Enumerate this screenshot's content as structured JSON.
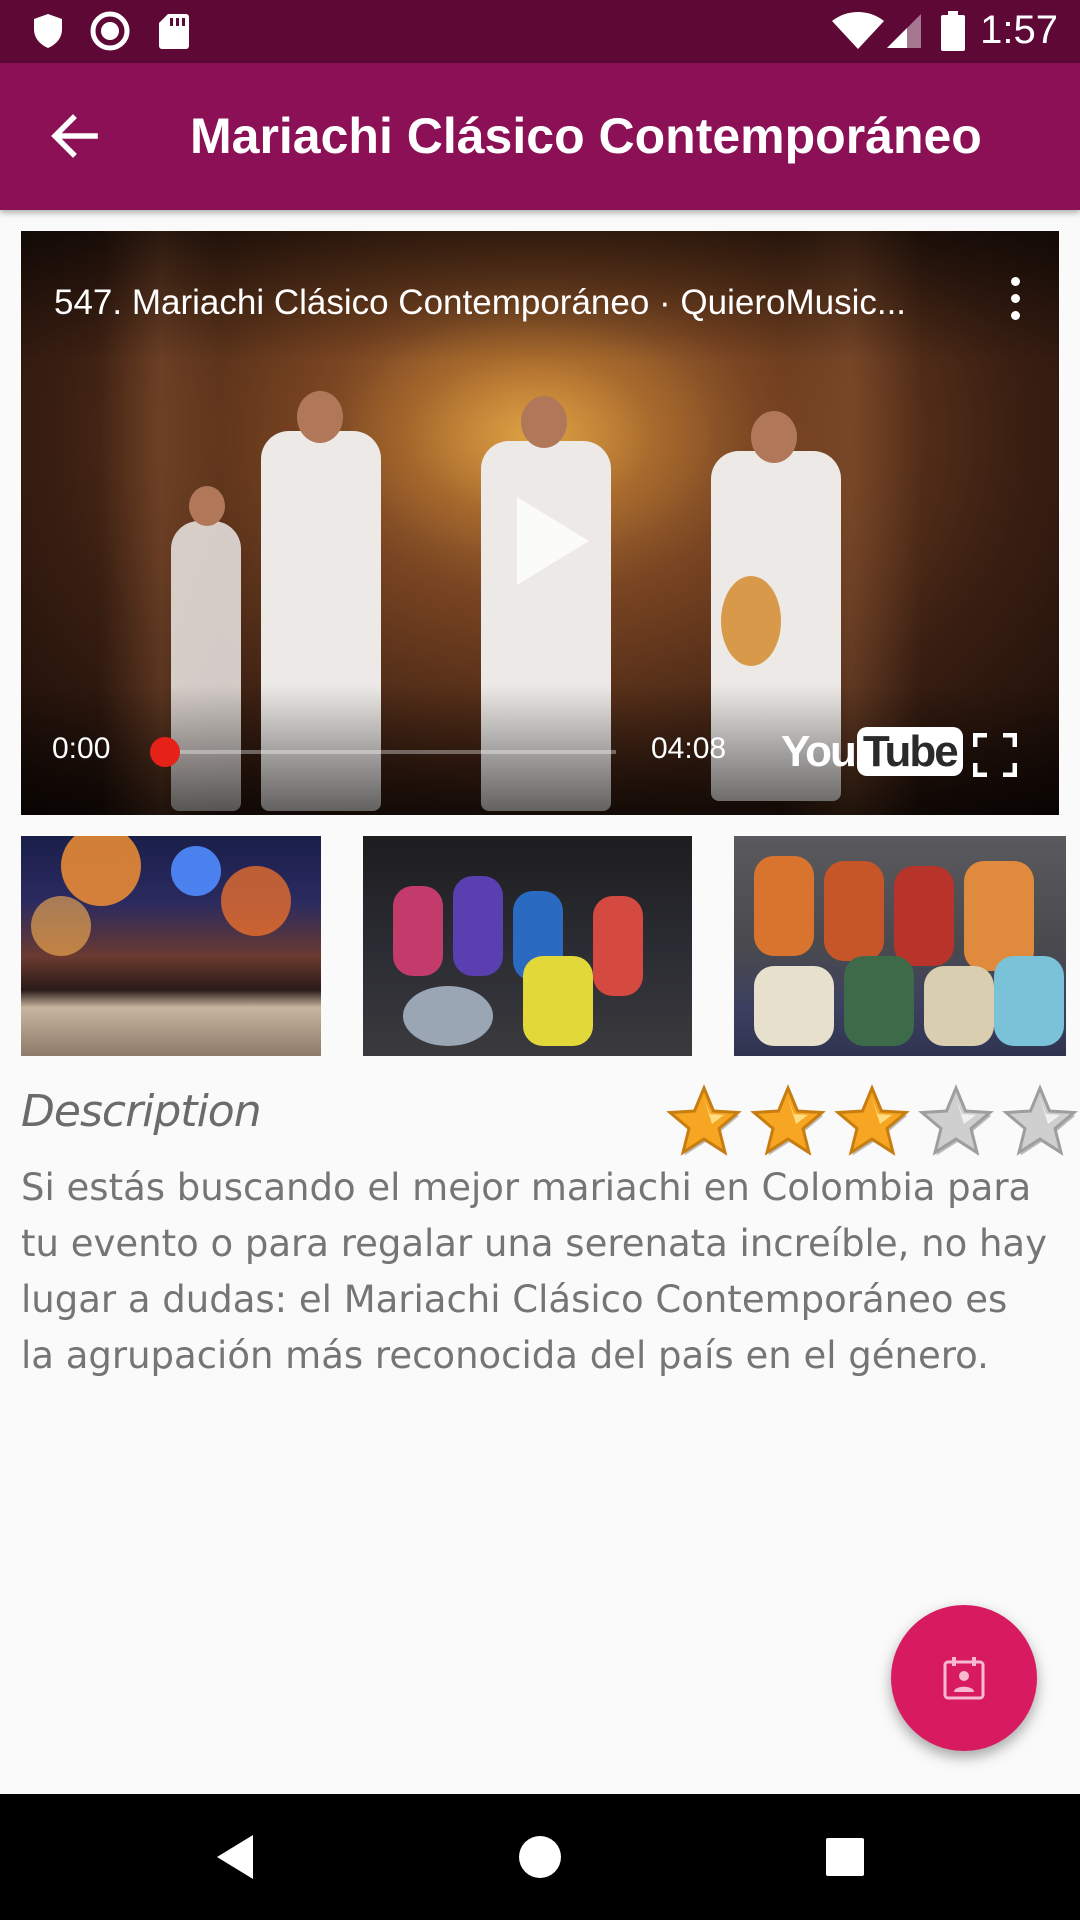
{
  "status_bar": {
    "time": "1:57",
    "icons": [
      "shield-icon",
      "record-icon",
      "sd-card-icon",
      "wifi-icon",
      "signal-icon",
      "battery-icon"
    ]
  },
  "app_bar": {
    "title": "Mariachi Clásico Contemporáneo",
    "back_icon": "arrow-back-icon",
    "background": "#8b1056",
    "status_background": "#5e0836"
  },
  "video": {
    "title": "547. Mariachi Clásico Contemporáneo · QuieroMusic...",
    "current_time": "0:00",
    "duration": "04:08",
    "progress": 0,
    "logo_you": "You",
    "logo_tube": "Tube",
    "progress_color": "#e62117"
  },
  "thumbnails": [
    {
      "name": "concert-stage-thumbnail"
    },
    {
      "name": "band-rehearsal-thumbnail"
    },
    {
      "name": "ensemble-group-thumbnail"
    }
  ],
  "description": {
    "label": "Description",
    "text": "Si estás buscando el mejor mariachi en Colombia para tu evento o para regalar una serenata increíble, no hay lugar a dudas: el Mariachi Clásico Contemporáneo es la agrupación más reconocida del país en el género.",
    "rating": 3,
    "rating_max": 5
  },
  "fab": {
    "icon": "contact-calendar-icon",
    "color": "#d81b60"
  },
  "nav_bar": {
    "icons": [
      "back-triangle-icon",
      "home-circle-icon",
      "recents-square-icon"
    ]
  }
}
